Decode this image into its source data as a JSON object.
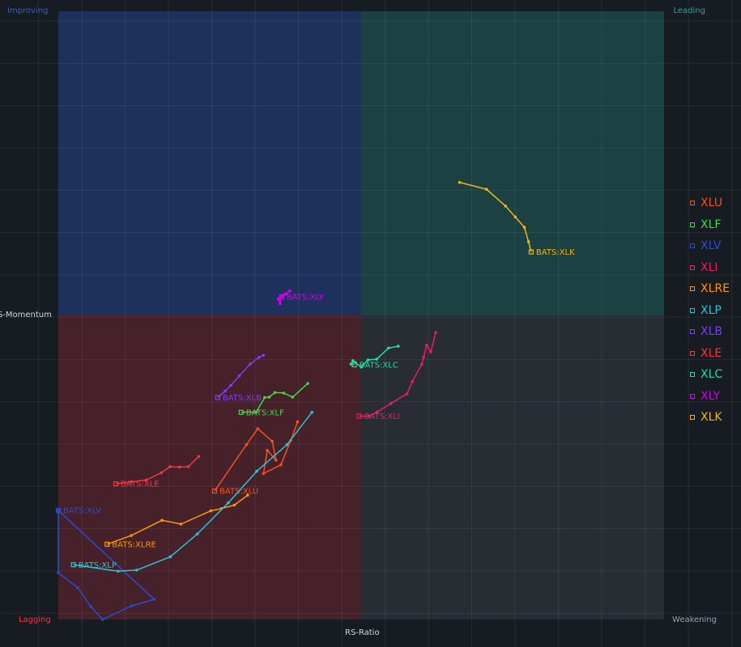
{
  "chart_data": {
    "type": "scatter",
    "subtype": "relative-rotation-graph",
    "xlabel": "RS-Ratio",
    "ylabel": "RS-Momentum",
    "xlim": [
      92,
      108
    ],
    "ylim": [
      92,
      108
    ],
    "grid": true,
    "legend_position": "right",
    "quadrants": {
      "top_left": {
        "label": "Improving",
        "color": "#2a5fd6"
      },
      "top_right": {
        "label": "Leading",
        "color": "#26a69a"
      },
      "bottom_left": {
        "label": "Lagging",
        "color": "#f23645"
      },
      "bottom_right": {
        "label": "Weakening",
        "color": "#9aa1ad"
      }
    },
    "series": [
      {
        "name": "XLU",
        "label": "BATS:XLU",
        "color": "#f4511e",
        "points": [
          [
            98.32,
            97.2
          ],
          [
            98.14,
            96.71
          ],
          [
            97.88,
            96.07
          ],
          [
            97.42,
            95.84
          ],
          [
            97.52,
            96.45
          ],
          [
            97.75,
            96.19
          ],
          [
            97.65,
            96.69
          ],
          [
            97.27,
            97.02
          ],
          [
            96.97,
            96.6
          ],
          [
            96.13,
            95.38
          ]
        ]
      },
      {
        "name": "XLF",
        "label": "BATS:XLF",
        "color": "#3ddc46",
        "points": [
          [
            98.59,
            98.21
          ],
          [
            98.19,
            97.85
          ],
          [
            97.95,
            97.96
          ],
          [
            97.72,
            97.97
          ],
          [
            97.57,
            97.85
          ],
          [
            97.45,
            97.84
          ],
          [
            97.23,
            97.46
          ],
          [
            96.83,
            97.45
          ]
        ]
      },
      {
        "name": "XLV",
        "label": "BATS:XLV",
        "color": "#2a4bd6",
        "points": [
          [
            92.0,
            94.87
          ],
          [
            92.0,
            93.23
          ],
          [
            92.51,
            92.84
          ],
          [
            92.86,
            92.34
          ],
          [
            93.17,
            92.0
          ],
          [
            93.94,
            92.36
          ],
          [
            94.53,
            92.53
          ],
          [
            92.0,
            94.87
          ]
        ]
      },
      {
        "name": "XLI",
        "label": "BATS:XLI",
        "color": "#e91e63",
        "points": [
          [
            101.97,
            99.55
          ],
          [
            101.84,
            99.04
          ],
          [
            101.73,
            99.22
          ],
          [
            101.65,
            98.9
          ],
          [
            101.6,
            98.71
          ],
          [
            101.35,
            98.26
          ],
          [
            101.21,
            97.94
          ],
          [
            100.78,
            97.68
          ],
          [
            100.42,
            97.46
          ],
          [
            100.2,
            97.35
          ],
          [
            99.95,
            97.35
          ]
        ]
      },
      {
        "name": "XLRE",
        "label": "BATS:XLRE",
        "color": "#ff9800",
        "points": [
          [
            97.0,
            95.27
          ],
          [
            96.65,
            95.01
          ],
          [
            96.31,
            94.92
          ],
          [
            96.03,
            94.86
          ],
          [
            95.24,
            94.51
          ],
          [
            94.74,
            94.61
          ],
          [
            93.93,
            94.21
          ],
          [
            93.29,
            93.98
          ]
        ]
      },
      {
        "name": "XLP",
        "label": "BATS:XLP",
        "color": "#26c6da",
        "points": [
          [
            98.7,
            97.45
          ],
          [
            98.04,
            96.6
          ],
          [
            97.24,
            95.9
          ],
          [
            96.49,
            95.07
          ],
          [
            95.67,
            94.25
          ],
          [
            94.96,
            93.65
          ],
          [
            94.07,
            93.3
          ],
          [
            93.58,
            93.27
          ],
          [
            92.4,
            93.44
          ]
        ]
      },
      {
        "name": "XLB",
        "label": "BATS:XLB",
        "color": "#7e3ff2",
        "points": [
          [
            97.42,
            98.95
          ],
          [
            97.3,
            98.9
          ],
          [
            97.07,
            98.72
          ],
          [
            96.78,
            98.41
          ],
          [
            96.56,
            98.16
          ],
          [
            96.41,
            98.01
          ],
          [
            96.21,
            97.84
          ]
        ]
      },
      {
        "name": "XLE",
        "label": "BATS:XLE",
        "color": "#f23645",
        "points": [
          [
            95.71,
            96.29
          ],
          [
            95.43,
            96.02
          ],
          [
            95.2,
            96.01
          ],
          [
            94.95,
            96.02
          ],
          [
            94.72,
            95.86
          ],
          [
            94.32,
            95.67
          ],
          [
            93.93,
            95.62
          ],
          [
            93.52,
            95.57
          ]
        ]
      },
      {
        "name": "XLC",
        "label": "BATS:XLC",
        "color": "#2bd9a0",
        "points": [
          [
            100.98,
            99.19
          ],
          [
            100.72,
            99.14
          ],
          [
            100.41,
            98.85
          ],
          [
            100.18,
            98.83
          ],
          [
            100.0,
            98.64
          ],
          [
            99.85,
            98.76
          ],
          [
            99.78,
            98.81
          ],
          [
            99.73,
            98.72
          ],
          [
            99.82,
            98.7
          ]
        ]
      },
      {
        "name": "XLY",
        "label": "BATS:XLY",
        "color": "#d400f0",
        "points": [
          [
            98.11,
            100.65
          ],
          [
            98.02,
            100.57
          ],
          [
            97.95,
            100.54
          ],
          [
            97.89,
            100.49
          ],
          [
            97.81,
            100.44
          ],
          [
            97.86,
            100.31
          ],
          [
            97.9,
            100.49
          ]
        ]
      },
      {
        "name": "XLK",
        "label": "BATS:XLK",
        "color": "#f2b418",
        "points": [
          [
            102.6,
            103.5
          ],
          [
            103.31,
            103.32
          ],
          [
            103.81,
            102.88
          ],
          [
            104.07,
            102.59
          ],
          [
            104.31,
            102.32
          ],
          [
            104.42,
            101.94
          ],
          [
            104.49,
            101.67
          ]
        ]
      }
    ]
  }
}
